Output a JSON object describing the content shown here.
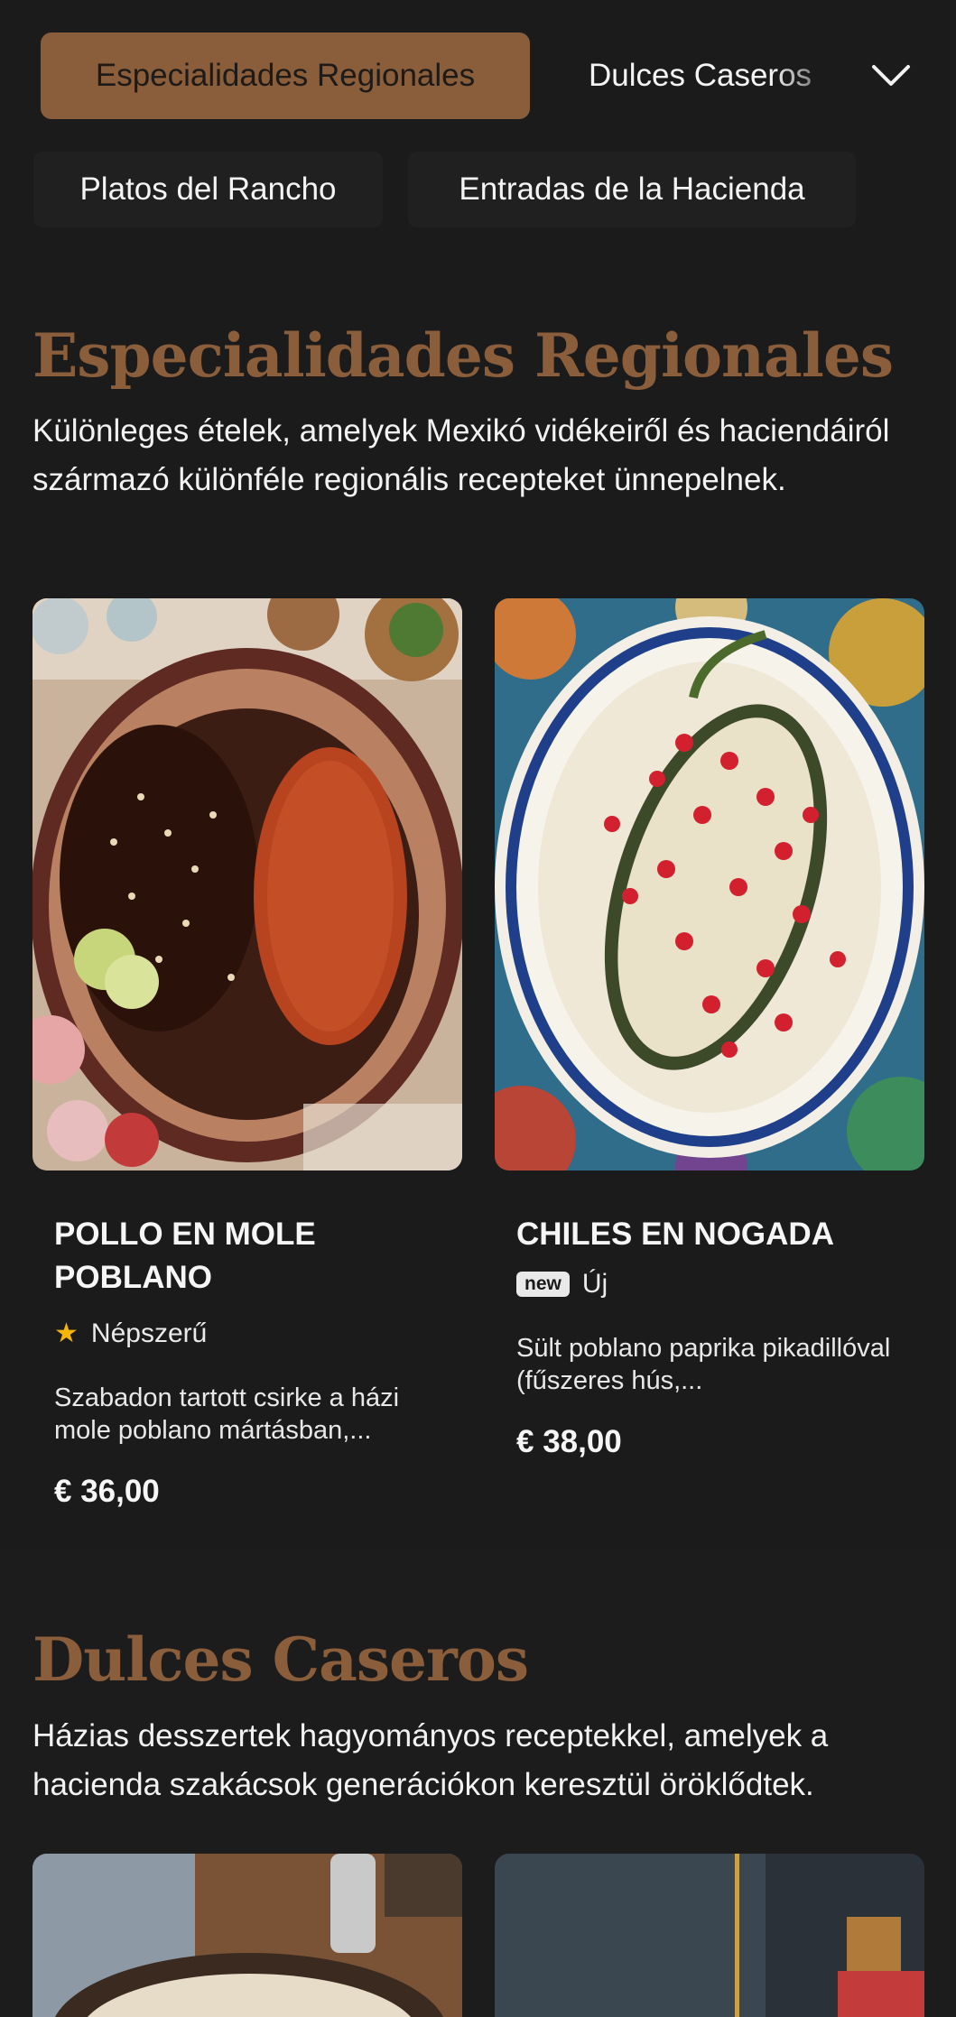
{
  "nav": {
    "active_tab": "Especialidades Regionales",
    "next_tab": "Dulces Caseros",
    "sub_tabs": [
      "Platos del Rancho",
      "Entradas de la Hacienda"
    ],
    "expand_icon": "chevron-down-icon"
  },
  "sections": [
    {
      "title": "Especialidades Regionales",
      "description": "Különleges ételek, amelyek Mexikó vidékeiről és haciendáiról származó különféle regionális recepteket ünnepelnek.",
      "items": [
        {
          "name": "POLLO EN MOLE POBLANO",
          "badge_label": "Népszerű",
          "badge_icon": "star-icon",
          "description": "Szabadon tartott csirke a házi mole poblano mártásban,...",
          "price": "€ 36,00"
        },
        {
          "name": "CHILES EN NOGADA",
          "badge_tag": "new",
          "badge_label": "Új",
          "description": "Sült poblano paprika pikadillóval (fűszeres hús,...",
          "price": "€ 38,00"
        }
      ]
    },
    {
      "title": "Dulces Caseros",
      "description": "Házias desszertek hagyományos receptekkel, amelyek a hacienda szakácsok generációkon keresztül öröklődtek."
    }
  ],
  "colors": {
    "background": "#1b1b1b",
    "accent": "#8a5d3b",
    "star": "#f5b50a"
  }
}
